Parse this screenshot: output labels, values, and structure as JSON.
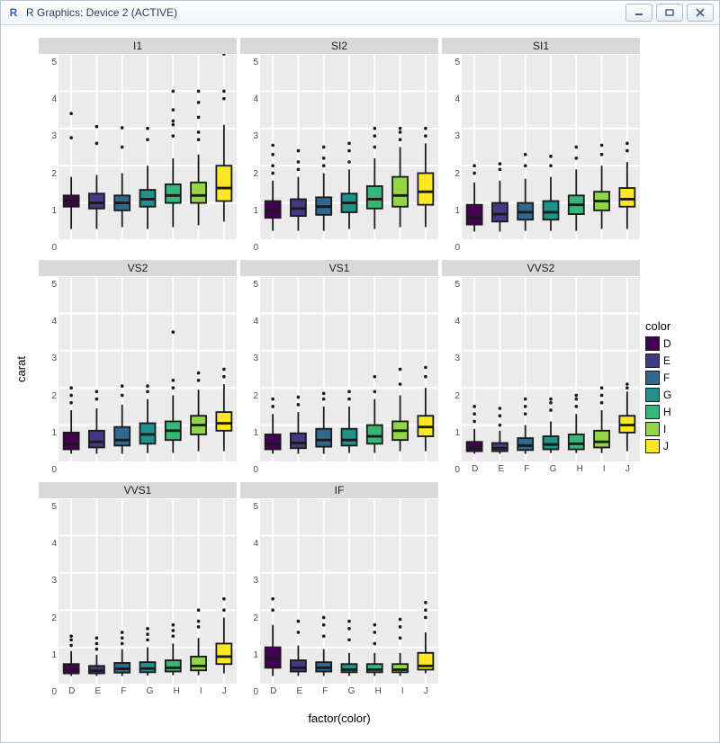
{
  "window": {
    "title": "R Graphics: Device 2 (ACTIVE)",
    "app_icon_text": "R",
    "minimize_label": "Minimize",
    "restore_label": "Restore",
    "close_label": "Close"
  },
  "chart_data": {
    "type": "box",
    "xlabel": "factor(color)",
    "ylabel": "carat",
    "categories": [
      "D",
      "E",
      "F",
      "G",
      "H",
      "I",
      "J"
    ],
    "ylim": [
      0,
      5
    ],
    "yticks": [
      0,
      1,
      2,
      3,
      4,
      5
    ],
    "legend_title": "color",
    "colors": {
      "D": "#440154",
      "E": "#443a83",
      "F": "#31688e",
      "G": "#21918c",
      "H": "#35b779",
      "I": "#90d743",
      "J": "#fde725"
    },
    "facets": [
      {
        "name": "I1",
        "row": 0,
        "col": 0,
        "show_x": false,
        "series": [
          {
            "name": "D",
            "q1": 0.9,
            "median": 1.05,
            "q3": 1.2,
            "lo": 0.3,
            "hi": 1.7,
            "out": [
              2.75,
              3.4
            ]
          },
          {
            "name": "E",
            "q1": 0.85,
            "median": 1.0,
            "q3": 1.25,
            "lo": 0.3,
            "hi": 1.75,
            "out": [
              2.6,
              3.05
            ]
          },
          {
            "name": "F",
            "q1": 0.8,
            "median": 1.0,
            "q3": 1.2,
            "lo": 0.35,
            "hi": 1.8,
            "out": [
              2.5,
              3.02
            ]
          },
          {
            "name": "G",
            "q1": 0.9,
            "median": 1.1,
            "q3": 1.35,
            "lo": 0.3,
            "hi": 2.0,
            "out": [
              2.7,
              3.0
            ]
          },
          {
            "name": "H",
            "q1": 1.0,
            "median": 1.2,
            "q3": 1.5,
            "lo": 0.35,
            "hi": 2.2,
            "out": [
              2.8,
              3.1,
              3.2,
              3.5,
              4.0
            ]
          },
          {
            "name": "I",
            "q1": 1.0,
            "median": 1.2,
            "q3": 1.55,
            "lo": 0.4,
            "hi": 2.3,
            "out": [
              2.7,
              2.9,
              3.3,
              3.7,
              4.0
            ]
          },
          {
            "name": "J",
            "q1": 1.05,
            "median": 1.4,
            "q3": 2.0,
            "lo": 0.5,
            "hi": 3.1,
            "out": [
              3.8,
              4.0,
              5.0
            ]
          }
        ]
      },
      {
        "name": "SI2",
        "row": 0,
        "col": 1,
        "show_x": false,
        "series": [
          {
            "name": "D",
            "q1": 0.6,
            "median": 0.8,
            "q3": 1.05,
            "lo": 0.25,
            "hi": 1.6,
            "out": [
              1.8,
              2.0,
              2.3,
              2.55
            ]
          },
          {
            "name": "E",
            "q1": 0.65,
            "median": 0.85,
            "q3": 1.1,
            "lo": 0.25,
            "hi": 1.7,
            "out": [
              1.9,
              2.1,
              2.4
            ]
          },
          {
            "name": "F",
            "q1": 0.68,
            "median": 0.9,
            "q3": 1.15,
            "lo": 0.25,
            "hi": 1.8,
            "out": [
              2.0,
              2.2,
              2.5
            ]
          },
          {
            "name": "G",
            "q1": 0.75,
            "median": 1.0,
            "q3": 1.25,
            "lo": 0.3,
            "hi": 1.9,
            "out": [
              2.1,
              2.4,
              2.6
            ]
          },
          {
            "name": "H",
            "q1": 0.85,
            "median": 1.1,
            "q3": 1.45,
            "lo": 0.3,
            "hi": 2.2,
            "out": [
              2.5,
              2.8,
              3.0
            ]
          },
          {
            "name": "I",
            "q1": 0.9,
            "median": 1.2,
            "q3": 1.7,
            "lo": 0.35,
            "hi": 2.5,
            "out": [
              2.7,
              2.9,
              3.0
            ]
          },
          {
            "name": "J",
            "q1": 0.95,
            "median": 1.3,
            "q3": 1.8,
            "lo": 0.35,
            "hi": 2.6,
            "out": [
              2.8,
              3.0
            ]
          }
        ]
      },
      {
        "name": "SI1",
        "row": 0,
        "col": 2,
        "show_x": false,
        "series": [
          {
            "name": "D",
            "q1": 0.42,
            "median": 0.6,
            "q3": 0.95,
            "lo": 0.23,
            "hi": 1.55,
            "out": [
              1.8,
              2.0
            ]
          },
          {
            "name": "E",
            "q1": 0.5,
            "median": 0.7,
            "q3": 1.0,
            "lo": 0.23,
            "hi": 1.6,
            "out": [
              1.9,
              2.05
            ]
          },
          {
            "name": "F",
            "q1": 0.55,
            "median": 0.75,
            "q3": 1.0,
            "lo": 0.25,
            "hi": 1.65,
            "out": [
              2.0,
              2.3
            ]
          },
          {
            "name": "G",
            "q1": 0.55,
            "median": 0.75,
            "q3": 1.05,
            "lo": 0.25,
            "hi": 1.7,
            "out": [
              2.0,
              2.25
            ]
          },
          {
            "name": "H",
            "q1": 0.7,
            "median": 0.95,
            "q3": 1.2,
            "lo": 0.25,
            "hi": 1.9,
            "out": [
              2.2,
              2.5
            ]
          },
          {
            "name": "I",
            "q1": 0.8,
            "median": 1.05,
            "q3": 1.3,
            "lo": 0.3,
            "hi": 2.0,
            "out": [
              2.3,
              2.55
            ]
          },
          {
            "name": "J",
            "q1": 0.9,
            "median": 1.1,
            "q3": 1.4,
            "lo": 0.3,
            "hi": 2.1,
            "out": [
              2.4,
              2.6
            ]
          }
        ]
      },
      {
        "name": "VS2",
        "row": 1,
        "col": 0,
        "show_x": false,
        "series": [
          {
            "name": "D",
            "q1": 0.35,
            "median": 0.5,
            "q3": 0.8,
            "lo": 0.23,
            "hi": 1.4,
            "out": [
              1.6,
              1.8,
              2.0
            ]
          },
          {
            "name": "E",
            "q1": 0.4,
            "median": 0.55,
            "q3": 0.85,
            "lo": 0.23,
            "hi": 1.45,
            "out": [
              1.7,
              1.9
            ]
          },
          {
            "name": "F",
            "q1": 0.45,
            "median": 0.6,
            "q3": 0.95,
            "lo": 0.23,
            "hi": 1.55,
            "out": [
              1.8,
              2.05
            ]
          },
          {
            "name": "G",
            "q1": 0.5,
            "median": 0.75,
            "q3": 1.05,
            "lo": 0.25,
            "hi": 1.7,
            "out": [
              1.9,
              2.05
            ]
          },
          {
            "name": "H",
            "q1": 0.6,
            "median": 0.85,
            "q3": 1.1,
            "lo": 0.25,
            "hi": 1.8,
            "out": [
              2.0,
              2.2,
              3.5
            ]
          },
          {
            "name": "I",
            "q1": 0.75,
            "median": 1.0,
            "q3": 1.25,
            "lo": 0.3,
            "hi": 1.95,
            "out": [
              2.2,
              2.4
            ]
          },
          {
            "name": "J",
            "q1": 0.85,
            "median": 1.05,
            "q3": 1.35,
            "lo": 0.3,
            "hi": 2.1,
            "out": [
              2.3,
              2.5
            ]
          }
        ]
      },
      {
        "name": "VS1",
        "row": 1,
        "col": 1,
        "show_x": false,
        "series": [
          {
            "name": "D",
            "q1": 0.35,
            "median": 0.5,
            "q3": 0.75,
            "lo": 0.23,
            "hi": 1.3,
            "out": [
              1.5,
              1.7
            ]
          },
          {
            "name": "E",
            "q1": 0.38,
            "median": 0.52,
            "q3": 0.78,
            "lo": 0.23,
            "hi": 1.35,
            "out": [
              1.55,
              1.75
            ]
          },
          {
            "name": "F",
            "q1": 0.42,
            "median": 0.6,
            "q3": 0.9,
            "lo": 0.23,
            "hi": 1.5,
            "out": [
              1.7,
              1.85
            ]
          },
          {
            "name": "G",
            "q1": 0.45,
            "median": 0.6,
            "q3": 0.9,
            "lo": 0.25,
            "hi": 1.5,
            "out": [
              1.7,
              1.9
            ]
          },
          {
            "name": "H",
            "q1": 0.5,
            "median": 0.7,
            "q3": 1.0,
            "lo": 0.25,
            "hi": 1.7,
            "out": [
              1.9,
              2.3
            ]
          },
          {
            "name": "I",
            "q1": 0.6,
            "median": 0.85,
            "q3": 1.1,
            "lo": 0.3,
            "hi": 1.8,
            "out": [
              2.1,
              2.5
            ]
          },
          {
            "name": "J",
            "q1": 0.7,
            "median": 0.95,
            "q3": 1.25,
            "lo": 0.3,
            "hi": 2.0,
            "out": [
              2.3,
              2.55
            ]
          }
        ]
      },
      {
        "name": "VVS2",
        "row": 1,
        "col": 2,
        "show_x": true,
        "series": [
          {
            "name": "D",
            "q1": 0.3,
            "median": 0.4,
            "q3": 0.55,
            "lo": 0.23,
            "hi": 0.9,
            "out": [
              1.1,
              1.3,
              1.5
            ]
          },
          {
            "name": "E",
            "q1": 0.3,
            "median": 0.38,
            "q3": 0.52,
            "lo": 0.23,
            "hi": 0.85,
            "out": [
              1.0,
              1.25,
              1.45
            ]
          },
          {
            "name": "F",
            "q1": 0.33,
            "median": 0.45,
            "q3": 0.65,
            "lo": 0.23,
            "hi": 1.0,
            "out": [
              1.3,
              1.5,
              1.7
            ]
          },
          {
            "name": "G",
            "q1": 0.35,
            "median": 0.48,
            "q3": 0.7,
            "lo": 0.25,
            "hi": 1.1,
            "out": [
              1.4,
              1.6,
              1.7
            ]
          },
          {
            "name": "H",
            "q1": 0.35,
            "median": 0.5,
            "q3": 0.75,
            "lo": 0.25,
            "hi": 1.3,
            "out": [
              1.5,
              1.7,
              1.8
            ]
          },
          {
            "name": "I",
            "q1": 0.4,
            "median": 0.55,
            "q3": 0.85,
            "lo": 0.25,
            "hi": 1.4,
            "out": [
              1.6,
              1.8,
              2.0
            ]
          },
          {
            "name": "J",
            "q1": 0.8,
            "median": 1.0,
            "q3": 1.25,
            "lo": 0.3,
            "hi": 1.9,
            "out": [
              2.0,
              2.1
            ]
          }
        ]
      },
      {
        "name": "VVS1",
        "row": 2,
        "col": 0,
        "show_x": true,
        "series": [
          {
            "name": "D",
            "q1": 0.3,
            "median": 0.4,
            "q3": 0.55,
            "lo": 0.23,
            "hi": 0.9,
            "out": [
              1.05,
              1.2,
              1.3
            ]
          },
          {
            "name": "E",
            "q1": 0.3,
            "median": 0.37,
            "q3": 0.5,
            "lo": 0.23,
            "hi": 0.8,
            "out": [
              0.95,
              1.1,
              1.25
            ]
          },
          {
            "name": "F",
            "q1": 0.32,
            "median": 0.42,
            "q3": 0.58,
            "lo": 0.23,
            "hi": 0.95,
            "out": [
              1.1,
              1.25,
              1.4
            ]
          },
          {
            "name": "G",
            "q1": 0.33,
            "median": 0.43,
            "q3": 0.6,
            "lo": 0.24,
            "hi": 1.0,
            "out": [
              1.2,
              1.35,
              1.5
            ]
          },
          {
            "name": "H",
            "q1": 0.35,
            "median": 0.45,
            "q3": 0.65,
            "lo": 0.25,
            "hi": 1.1,
            "out": [
              1.3,
              1.45,
              1.6
            ]
          },
          {
            "name": "I",
            "q1": 0.38,
            "median": 0.5,
            "q3": 0.75,
            "lo": 0.25,
            "hi": 1.25,
            "out": [
              1.55,
              1.7,
              2.0
            ]
          },
          {
            "name": "J",
            "q1": 0.55,
            "median": 0.75,
            "q3": 1.1,
            "lo": 0.3,
            "hi": 1.8,
            "out": [
              2.0,
              2.3
            ]
          }
        ]
      },
      {
        "name": "IF",
        "row": 2,
        "col": 1,
        "show_x": true,
        "series": [
          {
            "name": "D",
            "q1": 0.45,
            "median": 0.7,
            "q3": 1.0,
            "lo": 0.23,
            "hi": 1.6,
            "out": [
              2.0,
              2.3
            ]
          },
          {
            "name": "E",
            "q1": 0.35,
            "median": 0.45,
            "q3": 0.65,
            "lo": 0.23,
            "hi": 1.05,
            "out": [
              1.4,
              1.7
            ]
          },
          {
            "name": "F",
            "q1": 0.35,
            "median": 0.45,
            "q3": 0.6,
            "lo": 0.23,
            "hi": 0.95,
            "out": [
              1.3,
              1.6,
              1.8
            ]
          },
          {
            "name": "G",
            "q1": 0.33,
            "median": 0.4,
            "q3": 0.55,
            "lo": 0.23,
            "hi": 0.85,
            "out": [
              1.2,
              1.5,
              1.7
            ]
          },
          {
            "name": "H",
            "q1": 0.33,
            "median": 0.4,
            "q3": 0.55,
            "lo": 0.23,
            "hi": 0.85,
            "out": [
              1.1,
              1.4,
              1.6
            ]
          },
          {
            "name": "I",
            "q1": 0.33,
            "median": 0.4,
            "q3": 0.55,
            "lo": 0.23,
            "hi": 0.85,
            "out": [
              1.25,
              1.55,
              1.75
            ]
          },
          {
            "name": "J",
            "q1": 0.4,
            "median": 0.5,
            "q3": 0.85,
            "lo": 0.3,
            "hi": 1.4,
            "out": [
              1.8,
              2.0,
              2.2
            ]
          }
        ]
      }
    ]
  }
}
